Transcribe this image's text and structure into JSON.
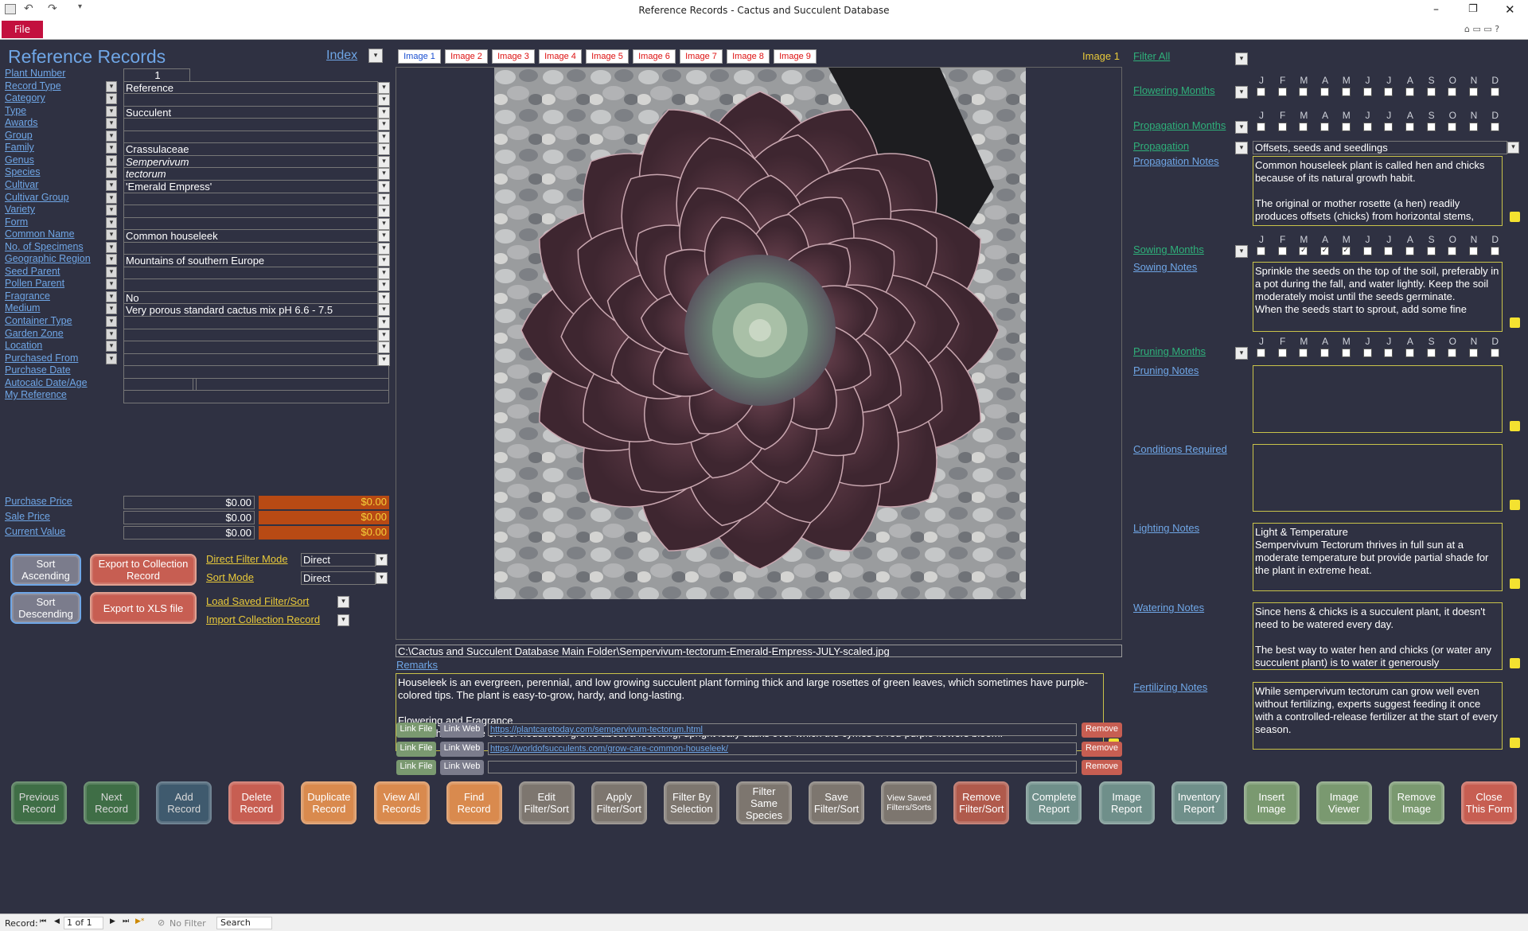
{
  "window": {
    "title": "Reference Records  -  Cactus and Succulent Database"
  },
  "ribbon": {
    "file": "File"
  },
  "header": {
    "title": "Reference Records",
    "index": "Index"
  },
  "fields": [
    {
      "label": "Plant Number",
      "value": "1",
      "type": "num"
    },
    {
      "label": "Record Type",
      "value": "Reference",
      "dd": true
    },
    {
      "label": "Category",
      "value": "",
      "dd": true
    },
    {
      "label": "Type",
      "value": "Succulent",
      "dd": true
    },
    {
      "label": "Awards",
      "value": "",
      "dd": true
    },
    {
      "label": "Group",
      "value": "",
      "dd": true
    },
    {
      "label": "Family",
      "value": "Crassulaceae",
      "dd": true
    },
    {
      "label": "Genus",
      "value": "Sempervivum",
      "dd": true,
      "italic": true
    },
    {
      "label": "Species",
      "value": "tectorum",
      "dd": true,
      "italic": true
    },
    {
      "label": "Cultivar",
      "value": "'Emerald Empress'",
      "dd": true
    },
    {
      "label": "Cultivar Group",
      "value": "",
      "dd": true
    },
    {
      "label": "Variety",
      "value": "",
      "dd": true
    },
    {
      "label": "Form",
      "value": "",
      "dd": true
    },
    {
      "label": "Common Name",
      "value": "Common houseleek",
      "dd": true
    },
    {
      "label": "No. of Specimens",
      "value": "",
      "dd": true
    },
    {
      "label": "Geographic Region",
      "value": "Mountains of southern Europe",
      "dd": true
    },
    {
      "label": "Seed Parent",
      "value": "",
      "dd": true
    },
    {
      "label": "Pollen Parent",
      "value": "",
      "dd": true
    },
    {
      "label": "Fragrance",
      "value": "No",
      "dd": true
    },
    {
      "label": "Medium",
      "value": "Very porous standard cactus mix pH 6.6 - 7.5",
      "dd": true
    },
    {
      "label": "Container Type",
      "value": "",
      "dd": true
    },
    {
      "label": "Garden Zone",
      "value": "",
      "dd": true
    },
    {
      "label": "Location",
      "value": "",
      "dd": true
    },
    {
      "label": "Purchased From",
      "value": "",
      "dd": true
    },
    {
      "label": "Purchase Date",
      "value": ""
    },
    {
      "label": "Autocalc Date/Age",
      "value": "",
      "split": true
    },
    {
      "label": "My Reference",
      "value": ""
    }
  ],
  "prices": [
    {
      "label": "Purchase Price",
      "value": "$0.00",
      "calc": "$0.00"
    },
    {
      "label": "Sale Price",
      "value": "$0.00",
      "calc": "$0.00"
    },
    {
      "label": "Current Value",
      "value": "$0.00",
      "calc": "$0.00"
    }
  ],
  "sort": {
    "ascending": "Sort Ascending",
    "descending": "Sort Descending",
    "export_collection": "Export to Collection Record",
    "export_xls": "Export to XLS file",
    "direct_filter_mode": "Direct Filter Mode",
    "direct_filter_value": "Direct",
    "sort_mode": "Sort Mode",
    "sort_mode_value": "Direct",
    "load_saved": "Load Saved Filter/Sort",
    "import_collection": "Import Collection Record"
  },
  "image_tabs": [
    "Image 1",
    "Image 2",
    "Image 3",
    "Image 4",
    "Image 5",
    "Image 6",
    "Image 7",
    "Image 8",
    "Image 9"
  ],
  "image_current": "Image 1",
  "image_path": "C:\\Cactus and Succulent Database Main Folder\\Sempervivum-tectorum-Emerald-Empress-JULY-scaled.jpg",
  "remarks": {
    "label": "Remarks",
    "text": "Houseleek is an evergreen, perennial, and low growing succulent plant forming thick and large rosettes of green leaves, which sometimes have purple-colored tips. The plant is easy-to-grow, hardy, and long-lasting.\n\nFlowering and Fragrance\nThe mother rosette of roof houseleek grows about a foot long, upright leafy stalks over which the cymes of red-purple flowers bloom."
  },
  "links": [
    {
      "file": "Link File",
      "web": "Link Web",
      "url": "https://plantcaretoday.com/sempervivum-tectorum.html",
      "remove": "Remove"
    },
    {
      "file": "Link File",
      "web": "Link Web",
      "url": "https://worldofsucculents.com/grow-care-common-houseleek/",
      "remove": "Remove"
    },
    {
      "file": "Link File",
      "web": "Link Web",
      "url": "",
      "remove": "Remove"
    }
  ],
  "right": {
    "filter_all": "Filter All",
    "months": [
      "J",
      "F",
      "M",
      "A",
      "M",
      "J",
      "J",
      "A",
      "S",
      "O",
      "N",
      "D"
    ],
    "flowering_months": {
      "label": "Flowering Months",
      "checked": []
    },
    "propagation_months": {
      "label": "Propagation Months",
      "checked": []
    },
    "propagation": {
      "label": "Propagation",
      "value": "Offsets, seeds and seedlings"
    },
    "propagation_notes": {
      "label": "Propagation Notes",
      "text": "Common houseleek plant is called hen and chicks because of its natural growth habit.\n\nThe original or mother rosette (a hen) readily produces offsets (chicks) from horizontal stems,"
    },
    "sowing_months": {
      "label": "Sowing Months",
      "checked": [
        2,
        3,
        4
      ]
    },
    "sowing_notes": {
      "label": "Sowing Notes",
      "text": "Sprinkle the seeds on the top of the soil, preferably in a pot during the fall, and water lightly. Keep the soil moderately moist until the seeds germinate.\nWhen the seeds start to sprout, add some fine"
    },
    "pruning_months": {
      "label": "Pruning Months",
      "checked": []
    },
    "pruning_notes": {
      "label": "Pruning Notes",
      "text": ""
    },
    "conditions_required": {
      "label": "Conditions Required",
      "text": ""
    },
    "lighting_notes": {
      "label": "Lighting Notes",
      "text": "Light & Temperature\nSempervivum Tectorum thrives in full sun at a moderate temperature but provide partial shade for the plant in extreme heat."
    },
    "watering_notes": {
      "label": "Watering Notes",
      "text": "Since hens & chicks is a succulent plant, it doesn't need to be watered every day.\n\nThe best way to water hen and chicks (or water any succulent plant) is to water it generously"
    },
    "fertilizing_notes": {
      "label": "Fertilizing Notes",
      "text": "While sempervivum tectorum can grow well even without fertilizing, experts suggest feeding it once with a controlled-release fertilizer at the start of every season."
    }
  },
  "bottom_buttons": [
    {
      "label": "Previous Record",
      "bg": "#3f6e46",
      "fg": "#d9d9d9"
    },
    {
      "label": "Next Record",
      "bg": "#3f6e46",
      "fg": "#d9d9d9"
    },
    {
      "label": "Add Record",
      "bg": "#3f5a6e",
      "fg": "#d9d9d9"
    },
    {
      "label": "Delete Record",
      "bg": "#c75e52",
      "fg": "#fff"
    },
    {
      "label": "Duplicate Record",
      "bg": "#d98a4e",
      "fg": "#fff"
    },
    {
      "label": "View All Records",
      "bg": "#d98a4e",
      "fg": "#fff"
    },
    {
      "label": "Find Record",
      "bg": "#d98a4e",
      "fg": "#fff"
    },
    {
      "label": "Edit Filter/Sort",
      "bg": "#7d766f",
      "fg": "#fff"
    },
    {
      "label": "Apply Filter/Sort",
      "bg": "#7d766f",
      "fg": "#fff"
    },
    {
      "label": "Filter By Selection",
      "bg": "#7d766f",
      "fg": "#fff"
    },
    {
      "label": "Filter Same Species",
      "bg": "#7d766f",
      "fg": "#fff"
    },
    {
      "label": "Save Filter/Sort",
      "bg": "#7d766f",
      "fg": "#fff"
    },
    {
      "label": "View Saved Filters/Sorts",
      "bg": "#7d766f",
      "fg": "#fff",
      "small": true
    },
    {
      "label": "Remove Filter/Sort",
      "bg": "#b05a4c",
      "fg": "#fff"
    },
    {
      "label": "Complete Report",
      "bg": "#6f8f8a",
      "fg": "#fff"
    },
    {
      "label": "Image Report",
      "bg": "#6f8f8a",
      "fg": "#fff"
    },
    {
      "label": "Inventory Report",
      "bg": "#6f8f8a",
      "fg": "#fff"
    },
    {
      "label": "Insert Image",
      "bg": "#7a9970",
      "fg": "#fff"
    },
    {
      "label": "Image Viewer",
      "bg": "#7a9970",
      "fg": "#fff"
    },
    {
      "label": "Remove Image",
      "bg": "#7a9970",
      "fg": "#fff"
    },
    {
      "label": "Close This Form",
      "bg": "#c75e52",
      "fg": "#fff"
    }
  ],
  "statusbar": {
    "record_label": "Record:",
    "position": "1 of 1",
    "filter": "No Filter",
    "search": "Search"
  }
}
